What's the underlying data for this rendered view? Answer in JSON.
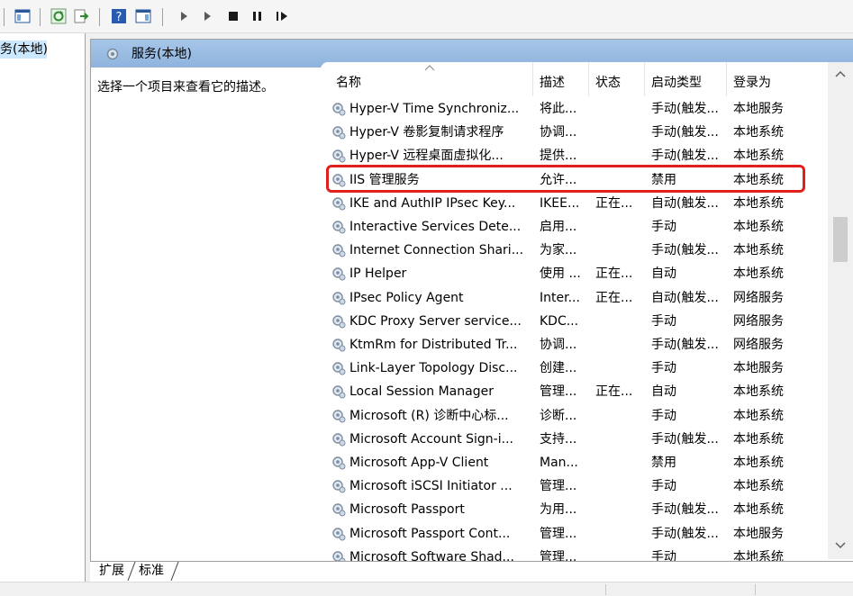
{
  "tree": {
    "selected_label": "服务(本地)"
  },
  "pane": {
    "title": "服务(本地)",
    "description_hint": "选择一个项目来查看它的描述。"
  },
  "columns": {
    "name": "名称",
    "desc": "描述",
    "status": "状态",
    "startup": "启动类型",
    "logon": "登录为"
  },
  "services": [
    {
      "name": "Hyper-V Time Synchroniz...",
      "desc": "将此...",
      "status": "",
      "startup": "手动(触发...",
      "logon": "本地服务"
    },
    {
      "name": "Hyper-V 卷影复制请求程序",
      "desc": "协调...",
      "status": "",
      "startup": "手动(触发...",
      "logon": "本地系统"
    },
    {
      "name": "Hyper-V 远程桌面虚拟化...",
      "desc": "提供...",
      "status": "",
      "startup": "手动(触发...",
      "logon": "本地系统"
    },
    {
      "name": "IIS 管理服务",
      "desc": "允许...",
      "status": "",
      "startup": "禁用",
      "logon": "本地系统"
    },
    {
      "name": "IKE and AuthIP IPsec Key...",
      "desc": "IKEE...",
      "status": "正在...",
      "startup": "自动(触发...",
      "logon": "本地系统"
    },
    {
      "name": "Interactive Services Dete...",
      "desc": "启用...",
      "status": "",
      "startup": "手动",
      "logon": "本地系统"
    },
    {
      "name": "Internet Connection Shari...",
      "desc": "为家...",
      "status": "",
      "startup": "手动(触发...",
      "logon": "本地系统"
    },
    {
      "name": "IP Helper",
      "desc": "使用 ...",
      "status": "正在...",
      "startup": "自动",
      "logon": "本地系统"
    },
    {
      "name": "IPsec Policy Agent",
      "desc": "Inter...",
      "status": "正在...",
      "startup": "自动(触发...",
      "logon": "网络服务"
    },
    {
      "name": "KDC Proxy Server service...",
      "desc": "KDC...",
      "status": "",
      "startup": "手动",
      "logon": "网络服务"
    },
    {
      "name": "KtmRm for Distributed Tr...",
      "desc": "协调...",
      "status": "",
      "startup": "手动(触发...",
      "logon": "网络服务"
    },
    {
      "name": "Link-Layer Topology Disc...",
      "desc": "创建...",
      "status": "",
      "startup": "手动",
      "logon": "本地服务"
    },
    {
      "name": "Local Session Manager",
      "desc": "管理...",
      "status": "正在...",
      "startup": "自动",
      "logon": "本地系统"
    },
    {
      "name": "Microsoft (R) 诊断中心标...",
      "desc": "诊断...",
      "status": "",
      "startup": "手动",
      "logon": "本地系统"
    },
    {
      "name": "Microsoft Account Sign-i...",
      "desc": "支持...",
      "status": "",
      "startup": "手动(触发...",
      "logon": "本地系统"
    },
    {
      "name": "Microsoft App-V Client",
      "desc": "Man...",
      "status": "",
      "startup": "禁用",
      "logon": "本地系统"
    },
    {
      "name": "Microsoft iSCSI Initiator ...",
      "desc": "管理...",
      "status": "",
      "startup": "手动",
      "logon": "本地系统"
    },
    {
      "name": "Microsoft Passport",
      "desc": "为用...",
      "status": "",
      "startup": "手动(触发...",
      "logon": "本地系统"
    },
    {
      "name": "Microsoft Passport Cont...",
      "desc": "管理...",
      "status": "",
      "startup": "手动(触发...",
      "logon": "本地服务"
    },
    {
      "name": "Microsoft Software Shad...",
      "desc": "管理...",
      "status": "",
      "startup": "手动",
      "logon": "本地系统"
    }
  ],
  "tabs": {
    "extended": "扩展",
    "standard": "标准"
  },
  "colors": {
    "header_blue": "#8fb3dd",
    "highlight_red": "#e0201c",
    "selection": "#cce8ff"
  },
  "icons": [
    "console-tree-icon",
    "properties-icon",
    "refresh-icon",
    "export-icon",
    "help-icon",
    "view-icon",
    "start-icon",
    "stop-icon",
    "pause-icon",
    "resume-icon",
    "service-gear-icon"
  ]
}
